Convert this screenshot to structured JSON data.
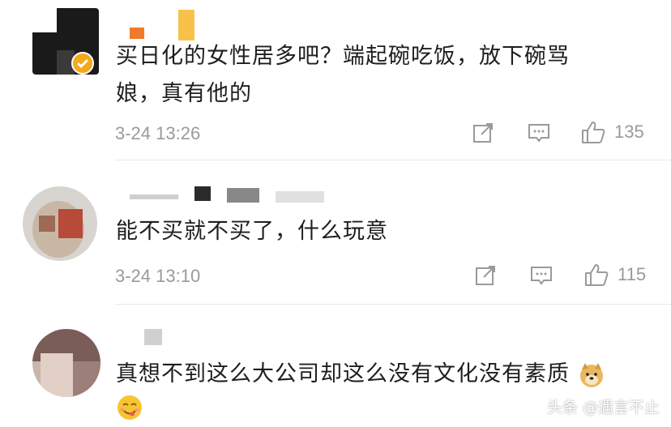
{
  "comments": [
    {
      "text_line1": "买日化的女性居多吧？端起碗吃饭，放下碗骂",
      "text_line2": "娘，真有他的",
      "time": "3-24 13:26",
      "likes": "135"
    },
    {
      "text_line1": "能不买就不买了，什么玩意",
      "time": "3-24 13:10",
      "likes": "115"
    },
    {
      "text_line1": "真想不到这么大公司却这么没有文化没有素质"
    }
  ],
  "watermark": "头条 @遇言不止",
  "icons": [
    "share-icon",
    "comment-icon",
    "like-icon",
    "verified-badge",
    "doge-emoji",
    "yum-emoji"
  ]
}
